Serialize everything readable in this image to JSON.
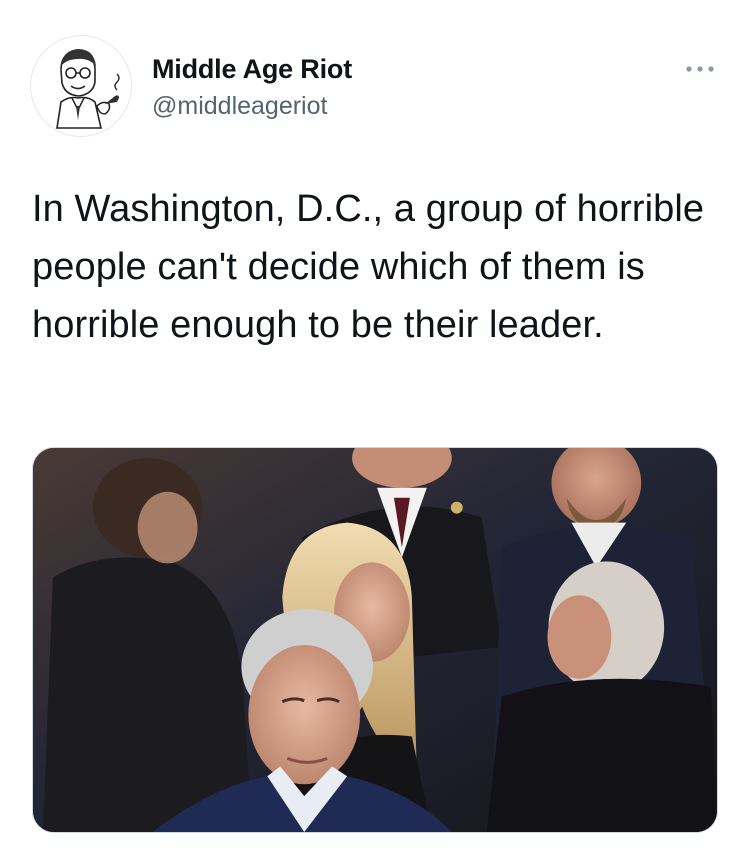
{
  "tweet": {
    "author": {
      "name": "Middle Age Riot",
      "handle": "@middleageriot",
      "avatar_icon": "cartoon-man-with-pipe"
    },
    "more_icon": "more-dots-icon",
    "text": "In Washington, D.C., a group of horrible people can't decide which of them is horrible enough to be their leader.",
    "media": {
      "type": "photo"
    }
  },
  "colors": {
    "text_primary": "#0f1419",
    "text_secondary": "#536471",
    "border": "#cfd9de"
  }
}
